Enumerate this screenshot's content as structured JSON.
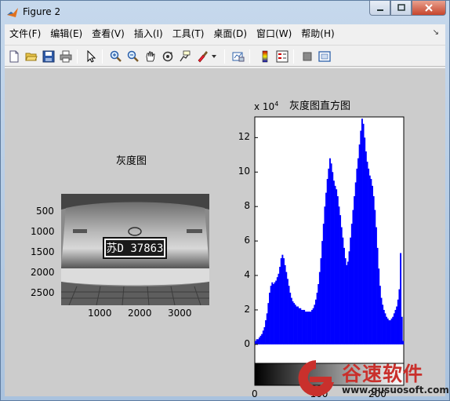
{
  "window": {
    "title": "Figure 2"
  },
  "menubar": {
    "items": [
      "文件(F)",
      "编辑(E)",
      "查看(V)",
      "插入(I)",
      "工具(T)",
      "桌面(D)",
      "窗口(W)",
      "帮助(H)"
    ]
  },
  "toolbar": {
    "buttons": [
      "new-figure-icon",
      "open-icon",
      "save-icon",
      "print-icon",
      "pointer-icon",
      "zoom-in-icon",
      "zoom-out-icon",
      "pan-icon",
      "rotate-3d-icon",
      "data-cursor-icon",
      "brush-icon",
      "brush-dropdown-icon",
      "link-plot-icon",
      "colorbar-icon",
      "legend-icon",
      "hide-plot-tools-icon",
      "show-plot-tools-icon"
    ]
  },
  "left_axes": {
    "title": "灰度图",
    "y_ticks": [
      "500",
      "1000",
      "1500",
      "2000",
      "2500"
    ],
    "x_ticks": [
      "1000",
      "2000",
      "3000"
    ],
    "plate_text": "苏D 37863"
  },
  "chart_data": {
    "type": "bar",
    "title": "灰度图直方图",
    "y_exponent_label": "x 10",
    "y_exponent_power": "4",
    "y_ticks": [
      "0",
      "2",
      "4",
      "6",
      "8",
      "10",
      "12"
    ],
    "x_ticks": [
      "0",
      "100",
      "200"
    ],
    "ylim": [
      -1.1,
      13.2
    ],
    "xlim": [
      0,
      255
    ],
    "colors": {
      "bars": "#0000ff",
      "background": "#ffffff"
    },
    "values": [
      0.2,
      0.3,
      0.3,
      0.4,
      0.5,
      0.6,
      0.8,
      1.0,
      1.4,
      1.8,
      2.4,
      3.0,
      3.4,
      3.6,
      3.5,
      3.6,
      3.7,
      3.9,
      4.1,
      4.5,
      5.0,
      5.2,
      5.0,
      4.6,
      4.2,
      3.8,
      3.4,
      3.0,
      2.7,
      2.5,
      2.4,
      2.3,
      2.2,
      2.2,
      2.1,
      2.1,
      2.0,
      2.0,
      2.0,
      1.9,
      1.9,
      1.9,
      1.9,
      1.9,
      2.0,
      2.1,
      2.3,
      2.6,
      3.0,
      3.5,
      4.2,
      5.0,
      6.0,
      7.0,
      8.0,
      8.8,
      9.6,
      10.2,
      10.8,
      10.5,
      10.0,
      9.5,
      9.2,
      9.0,
      8.6,
      8.0,
      7.5,
      6.8,
      6.2,
      5.6,
      5.0,
      4.6,
      4.8,
      5.4,
      6.2,
      7.0,
      7.8,
      8.6,
      9.4,
      10.2,
      10.8,
      11.6,
      12.4,
      13.1,
      12.8,
      12.0,
      11.2,
      10.6,
      10.2,
      9.8,
      9.6,
      9.2,
      8.6,
      7.8,
      6.8,
      5.6,
      4.4,
      3.4,
      2.7,
      2.3,
      2.0,
      1.8,
      1.6,
      1.5,
      1.4,
      1.4,
      1.5,
      1.6,
      1.8,
      2.0,
      2.2,
      2.6,
      3.2,
      5.3,
      1.6,
      0.2
    ]
  },
  "watermark": {
    "title": "谷速软件",
    "url": "www.gusuosoft.com",
    "color": "#c9302c"
  }
}
